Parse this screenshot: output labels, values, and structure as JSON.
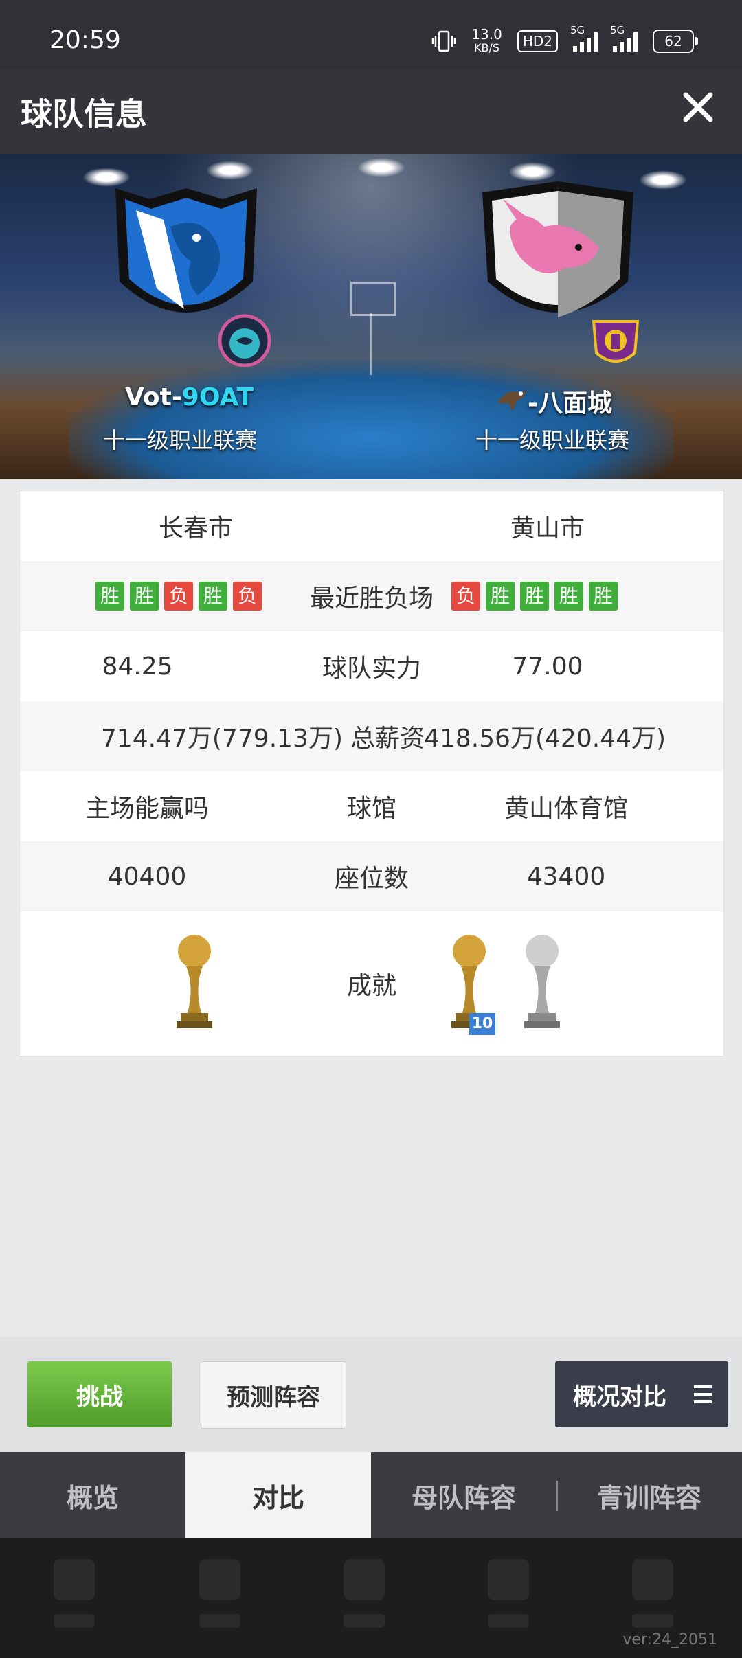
{
  "status_bar": {
    "time": "20:59",
    "speed_value": "13.0",
    "speed_unit": "KB/S",
    "hd_label": "HD2",
    "network1": "5G",
    "network2": "5G",
    "battery": "62"
  },
  "header": {
    "title": "球队信息"
  },
  "teams": {
    "home": {
      "name_prefix": "Vot-",
      "name_accent": "9OAT",
      "league": "十一级职业联赛",
      "city": "长春市"
    },
    "away": {
      "name": "-八面城",
      "league": "十一级职业联赛",
      "city": "黄山市"
    }
  },
  "stats": {
    "recent_label": "最近胜负场",
    "home_recent": [
      "胜",
      "胜",
      "负",
      "胜",
      "负"
    ],
    "away_recent": [
      "负",
      "胜",
      "胜",
      "胜",
      "胜"
    ],
    "strength_label": "球队实力",
    "home_strength": "84.25",
    "away_strength": "77.00",
    "salary_label": "总薪资",
    "home_salary": "714.47万(779.13万)",
    "away_salary": "418.56万(420.44万)",
    "arena_label": "球馆",
    "home_arena": "主场能赢吗",
    "away_arena": "黄山体育馆",
    "seats_label": "座位数",
    "home_seats": "40400",
    "away_seats": "43400",
    "achievements_label": "成就",
    "trophy_badge": "10"
  },
  "actions": {
    "challenge": "挑战",
    "predict": "预测阵容",
    "overview_compare": "概况对比"
  },
  "tabs": [
    "概览",
    "对比",
    "母队阵容",
    "青训阵容"
  ],
  "footer": {
    "version": "ver:24_2051"
  },
  "colors": {
    "win": "#3fae3b",
    "loss": "#e5493f",
    "accent": "#2fd7f0"
  }
}
